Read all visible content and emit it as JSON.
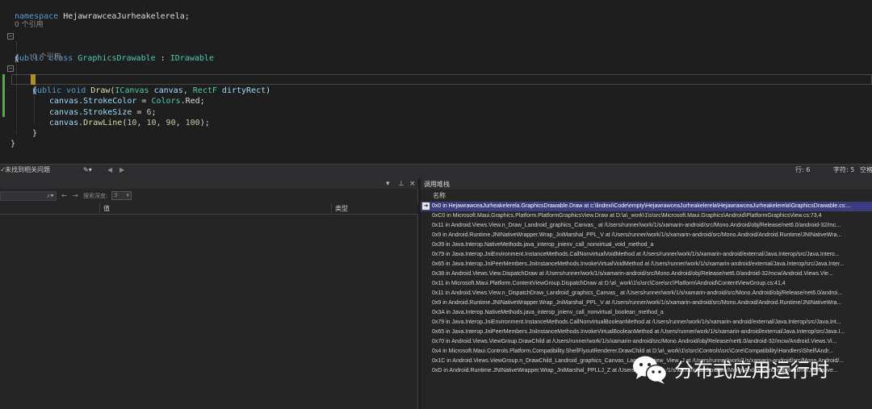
{
  "editor": {
    "namespace_kw": "namespace",
    "namespace_name": "HejawrawceaJurheakelerela;",
    "lens_class": "0 个引用",
    "class_public": "public",
    "class_kw": "class",
    "class_name": "GraphicsDrawable",
    "class_colon": ":",
    "class_iface": "IDrawable",
    "brace_open": "{",
    "lens_method": "0 个引用",
    "m_public": "public",
    "m_void": "void",
    "m_name": "Draw",
    "m_p1_type": "ICanvas",
    "m_p1_name": "canvas,",
    "m_p2_type": "RectF",
    "m_p2_name": "dirtyRect",
    "inner_brace": "{",
    "l1_obj": "canvas.",
    "l1_prop": "StrokeColor",
    "l1_eq": " = ",
    "l1_cls": "Colors",
    "l1_val": ".Red;",
    "l2_obj": "canvas.",
    "l2_prop": "StrokeSize",
    "l2_eq": " = ",
    "l2_num": "6",
    "l2_end": ";",
    "l3_obj": "canvas.",
    "l3_fn": "DrawLine",
    "l3_args_open": "(",
    "l3_a": "10",
    "l3_b": "10",
    "l3_c": "90",
    "l3_d": "100",
    "l3_close": ");",
    "comma": ", ",
    "close_inner": "}",
    "close_outer": "}"
  },
  "status": {
    "issues": "未找到相关问题",
    "line": "行: 6",
    "char": "字符: 5",
    "mode": "空格"
  },
  "left_panel": {
    "search_depth_label": "搜索深度:",
    "depth_value": "3",
    "col_value": "值",
    "col_type": "类型"
  },
  "callstack": {
    "title": "调用堆栈",
    "col_name": "名称",
    "frames": [
      "0x0 in HejawrawceaJurheakelerela.GraphicsDrawable.Draw at c:\\lindexi\\Code\\empty\\HejawrawceaJurheakelerela\\HejawrawceaJurheakelerela\\GraphicsDrawable.cs:...",
      "0xC0 in Microsoft.Maui.Graphics.Platform.PlatformGraphicsView.Draw at D:\\a\\_work\\1\\s\\src\\Microsoft.Maui.Graphics\\Android\\PlatformGraphicsView.cs:73,4",
      "0x11 in Android.Views.View.n_Draw_Landroid_graphics_Canvas_ at /Users/runner/work/1/s/xamarin-android/src/Mono.Android/obj/Release/net6.0/android-32/mc...",
      "0x9 in Android.Runtime.JNINativeWrapper.Wrap_JniMarshal_PPL_V at /Users/runner/work/1/s/xamarin-android/src/Mono.Android/Android.Runtime/JNINativeWra...",
      "0x39 in Java.Interop.NativeMethods.java_interop_jnienv_call_nonvirtual_void_method_a",
      "0x79 in Java.Interop.JniEnvironment.InstanceMethods.CallNonvirtualVoidMethod at /Users/runner/work/1/s/xamarin-android/external/Java.Interop/src/Java.Intero...",
      "0x65 in Java.Interop.JniPeerMembers.JniInstanceMethods.InvokeVirtualVoidMethod at /Users/runner/work/1/s/xamarin-android/external/Java.Interop/src/Java.Inter...",
      "0x38 in Android.Views.View.DispatchDraw at /Users/runner/work/1/s/xamarin-android/src/Mono.Android/obj/Release/net6.0/android-32/mcw/Android.Views.Vie...",
      "0x11 in Microsoft.Maui.Platform.ContentViewGroup.DispatchDraw at D:\\a\\_work\\1\\s\\src\\Core\\src\\Platform\\Android\\ContentViewGroup.cs:41,4",
      "0x11 in Android.Views.View.n_DispatchDraw_Landroid_graphics_Canvas_ at /Users/runner/work/1/s/xamarin-android/src/Mono.Android/obj/Release/net6.0/androi...",
      "0x9 in Android.Runtime.JNINativeWrapper.Wrap_JniMarshal_PPL_V at /Users/runner/work/1/s/xamarin-android/src/Mono.Android/Android.Runtime/JNINativeWra...",
      "0x3A in Java.Interop.NativeMethods.java_interop_jnienv_call_nonvirtual_boolean_method_a",
      "0x79 in Java.Interop.JniEnvironment.InstanceMethods.CallNonvirtualBooleanMethod at /Users/runner/work/1/s/xamarin-android/external/Java.Interop/src/Java.Int...",
      "0x65 in Java.Interop.JniPeerMembers.JniInstanceMethods.InvokeVirtualBooleanMethod at /Users/runner/work/1/s/xamarin-android/external/Java.Interop/src/Java.I...",
      "0x70 in Android.Views.ViewGroup.DrawChild at /Users/runner/work/1/s/xamarin-android/src/Mono.Android/obj/Release/net6.0/android-32/mcw/Android.Views.Vi...",
      "0x4 in Microsoft.Maui.Controls.Platform.Compatibility.ShellFlyoutRenderer.DrawChild at D:\\a\\_work\\1\\s\\src\\Controls\\src\\Core\\Compatibility\\Handlers\\Shell\\Andr...",
      "0x1C in Android.Views.ViewGroup.n_DrawChild_Landroid_graphics_Canvas_Landroid_view_View_J at /Users/runner/work/1/s/xamarin-android/src/Mono.Android/...",
      "0xD in Android.Runtime.JNINativeWrapper.Wrap_JniMarshal_PPLLJ_Z at /Users/runner/work/1/s/xamarin-android/src/Mono.Android/Android.Runtime/JNINative..."
    ]
  },
  "watermark": {
    "text": "分布式应用运行时"
  },
  "colors": {
    "editor_bg": "#1e1e1e",
    "panel_bg": "#252526",
    "active_frame": "#3e3b7e",
    "keyword": "#569cd6",
    "type": "#4ec9b0",
    "method": "#dcdcaa",
    "number": "#b5cea8",
    "changebar": "#57a64a"
  }
}
